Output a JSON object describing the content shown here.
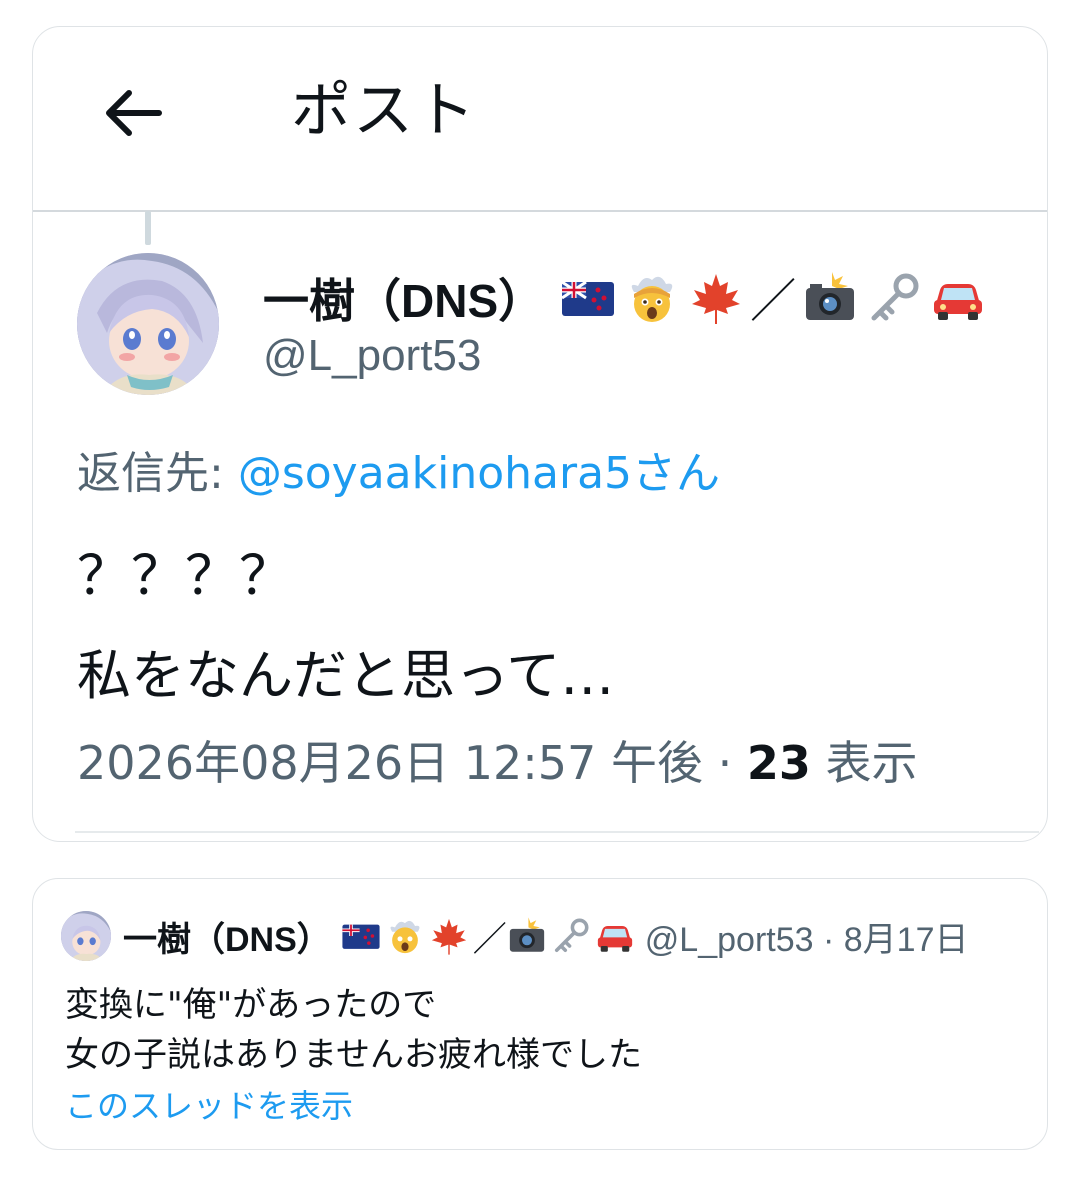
{
  "header": {
    "title": "ポスト",
    "back_icon": "arrow-left-icon"
  },
  "post": {
    "display_name": "一樹（DNS）",
    "name_emojis": [
      "nz-flag-icon",
      "exploding-head-icon",
      "maple-leaf-icon",
      "slash-icon",
      "camera-flash-icon",
      "key-icon",
      "car-icon"
    ],
    "slash": "／",
    "handle": "@L_port53",
    "reply_label": "返信先: ",
    "reply_target": "@soyaakinohara5さん",
    "text_line1": "？？？？",
    "text_line2": "私をなんだと思って…",
    "timestamp": "2026年08月26日 12:57 午後",
    "separator": " · ",
    "views_count": "23",
    "views_label": " 表示"
  },
  "quote": {
    "display_name": "一樹（DNS）",
    "slash": "／",
    "handle_date": "@L_port53 · 8月17日",
    "text_line1": "変換に\"俺\"があったので",
    "text_line2": "女の子説はありませんお疲れ様でした",
    "show_thread": "このスレッドを表示"
  },
  "colors": {
    "link": "#1d9bf0",
    "secondary": "#536471",
    "text": "#0f1419",
    "border": "#dfe3e6"
  }
}
